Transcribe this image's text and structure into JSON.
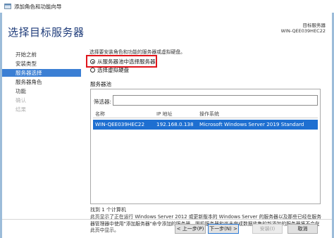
{
  "window": {
    "title": "添加角色和功能向导"
  },
  "header": {
    "title": "选择目标服务器",
    "dest_label": "目标服务器",
    "dest_value": "WIN-QEE039HEC22"
  },
  "nav": {
    "items": [
      {
        "label": "开始之前",
        "state": "normal"
      },
      {
        "label": "安装类型",
        "state": "normal"
      },
      {
        "label": "服务器选择",
        "state": "active"
      },
      {
        "label": "服务器角色",
        "state": "normal"
      },
      {
        "label": "功能",
        "state": "normal"
      },
      {
        "label": "确认",
        "state": "disabled"
      },
      {
        "label": "结果",
        "state": "disabled"
      }
    ]
  },
  "main": {
    "description": "选择要安装角色和功能的服务器或虚拟硬盘。",
    "options": [
      {
        "label": "从服务器池中选择服务器",
        "checked": true
      },
      {
        "label": "选择虚拟硬盘",
        "checked": false
      }
    ],
    "pool_label": "服务器池",
    "filter_label": "筛选器:",
    "filter_value": "",
    "table": {
      "columns": [
        "名称",
        "IP 地址",
        "操作系统"
      ],
      "rows": [
        {
          "name": "WIN-QEE039HEC22",
          "ip": "192.168.0.138",
          "os": "Microsoft Windows Server 2019 Standard"
        }
      ]
    },
    "found_count": "找到 1 个计算机",
    "info_text": "此页显示了正在运行 Windows Server 2012 或更新版本的 Windows Server 的服务器以及那些已经在服务器管理器中使用\"添加服务器\"命令添加的服务器。脱机服务器和尚未完成数据收集的新添加的服务器将不会在此页中显示。"
  },
  "footer": {
    "prev_label": "< 上一步(P)",
    "next_label": "下一步(N) >",
    "install_label": "安装(I)",
    "cancel_label": "取消"
  },
  "colors": {
    "title_blue": "#1f3c7a",
    "nav_active": "#3b7fd4",
    "row_selected": "#1e6fd1",
    "highlight_red": "#e0151b"
  }
}
